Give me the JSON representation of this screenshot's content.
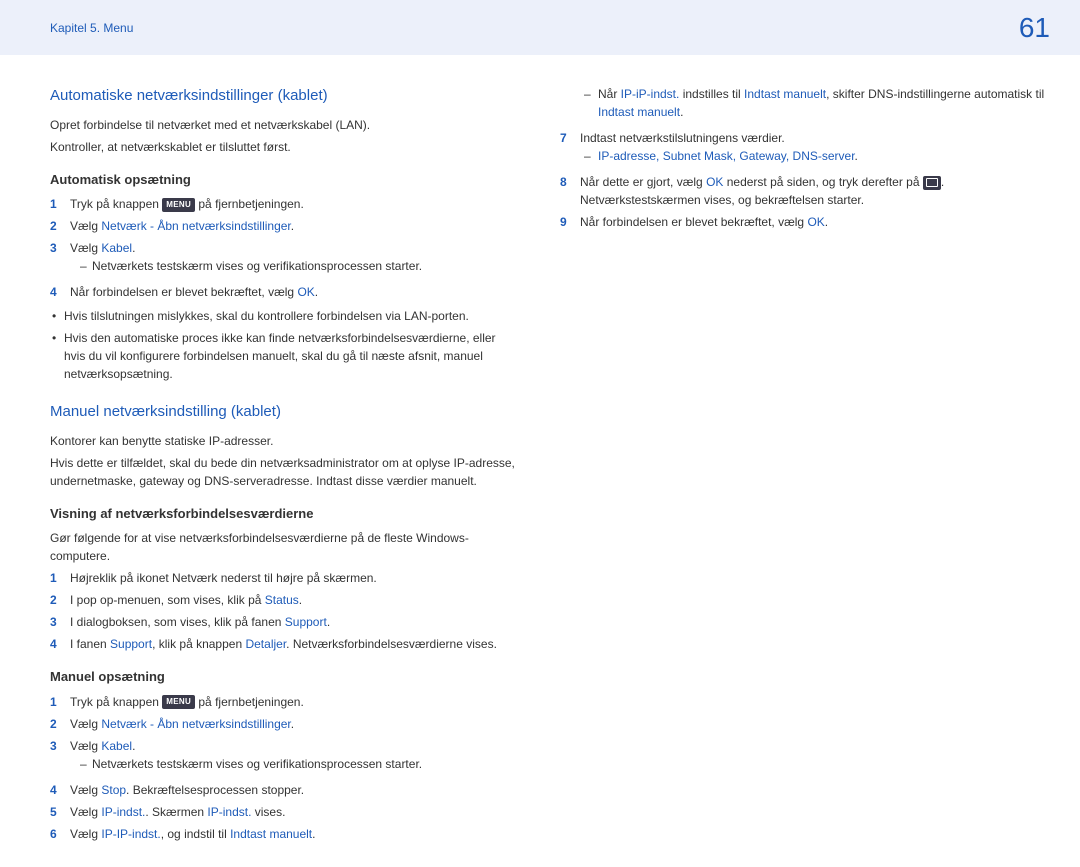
{
  "header": {
    "breadcrumb": "Kapitel 5. Menu",
    "page_number": "61"
  },
  "left": {
    "h2_auto": "Automatiske netværksindstillinger (kablet)",
    "p_auto1": "Opret forbindelse til netværket med et netværkskabel (LAN).",
    "p_auto2": "Kontroller, at netværkskablet er tilsluttet først.",
    "h3_auto_setup": "Automatisk opsætning",
    "step_a1_pre": "Tryk på knappen ",
    "menu_label": "MENU",
    "step_a1_post": " på fjernbetjeningen.",
    "step_a2_pre": "Vælg ",
    "step_a2_link": "Netværk - Åbn netværksindstillinger",
    "step_a2_post": ".",
    "step_a3_pre": "Vælg ",
    "step_a3_link": "Kabel",
    "step_a3_post": ".",
    "dash_a": "Netværkets testskærm vises og verifikationsprocessen starter.",
    "step_a4_pre": "Når forbindelsen er blevet bekræftet, vælg ",
    "step_a4_link": "OK",
    "step_a4_post": ".",
    "bullet1": "Hvis tilslutningen mislykkes, skal du kontrollere forbindelsen via LAN-porten.",
    "bullet2": "Hvis den automatiske proces ikke kan finde netværksforbindelsesværdierne, eller hvis du vil konfigurere forbindelsen manuelt, skal du gå til næste afsnit, manuel netværksopsætning.",
    "h2_manual": "Manuel netværksindstilling (kablet)",
    "p_man1": "Kontorer kan benytte statiske IP-adresser.",
    "p_man2": "Hvis dette er tilfældet, skal du bede din netværksadministrator om at oplyse IP-adresse, undernetmaske, gateway og DNS-serveradresse. Indtast disse værdier manuelt.",
    "h3_view": "Visning af netværksforbindelsesværdierne",
    "p_view": "Gør følgende for at vise netværksforbindelsesværdierne på de fleste Windows-computere.",
    "step_v1": "Højreklik på ikonet Netværk nederst til højre på skærmen.",
    "step_v2_pre": "I pop op-menuen, som vises, klik på ",
    "step_v2_link": "Status",
    "step_v2_post": ".",
    "step_v3_pre": "I dialogboksen, som vises, klik på fanen ",
    "step_v3_link": "Support",
    "step_v3_post": ".",
    "step_v4_pre": "I fanen ",
    "step_v4_link1": "Support",
    "step_v4_mid": ", klik på knappen ",
    "step_v4_link2": "Detaljer",
    "step_v4_post": ". Netværksforbindelsesværdierne vises.",
    "h3_man_setup": "Manuel opsætning",
    "step_m1_pre": "Tryk på knappen ",
    "step_m1_post": " på fjernbetjeningen.",
    "step_m2_pre": "Vælg ",
    "step_m2_link": "Netværk - Åbn netværksindstillinger",
    "step_m2_post": ".",
    "step_m3_pre": "Vælg ",
    "step_m3_link": "Kabel",
    "step_m3_post": ".",
    "dash_m": "Netværkets testskærm vises og verifikationsprocessen starter.",
    "step_m4_pre": "Vælg ",
    "step_m4_link": "Stop",
    "step_m4_post": ". Bekræftelsesprocessen stopper.",
    "step_m5_pre": "Vælg ",
    "step_m5_link1": "IP-indst.",
    "step_m5_mid": ". Skærmen ",
    "step_m5_link2": "IP-indst.",
    "step_m5_post": " vises.",
    "step_m6_pre": "Vælg ",
    "step_m6_link1": "IP-IP-indst.",
    "step_m6_mid": ", og indstil til ",
    "step_m6_link2": "Indtast manuelt",
    "step_m6_post": "."
  },
  "right": {
    "dash_r1_pre": "Når ",
    "dash_r1_link1": "IP-iP-indst.",
    "dash_r1_mid": " indstilles til ",
    "dash_r1_link2": "Indtast manuelt",
    "dash_r1_post": ", skifter DNS-indstillingerne automatisk til ",
    "dash_r1_link3": "Indtast manuelt",
    "dash_r1_end": ".",
    "step_r7": "Indtast netværkstilslutningens værdier.",
    "dash_r2": "IP-adresse, Subnet Mask, Gateway, DNS-server",
    "dash_r2_end": ".",
    "step_r8_pre": "Når dette er gjort, vælg ",
    "step_r8_link": "OK",
    "step_r8_mid": " nederst på siden, og tryk derefter på ",
    "step_r8_post": ". Netværkstestskærmen vises, og bekræftelsen starter.",
    "step_r9_pre": "Når forbindelsen er blevet bekræftet, vælg ",
    "step_r9_link": "OK",
    "step_r9_post": "."
  }
}
